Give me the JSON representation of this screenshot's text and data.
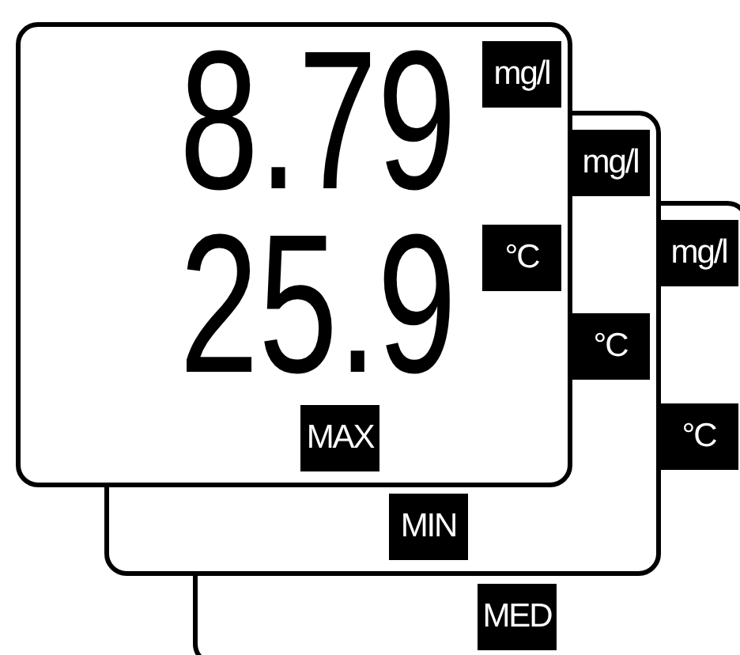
{
  "displays": [
    {
      "readings": [
        "8.79",
        "25.9"
      ],
      "units": [
        "mg/l",
        "°C"
      ],
      "mode": "MAX"
    },
    {
      "units": [
        "mg/l",
        "°C"
      ],
      "mode": "MIN"
    },
    {
      "units": [
        "mg/l",
        "°C"
      ],
      "mode": "MED"
    }
  ]
}
